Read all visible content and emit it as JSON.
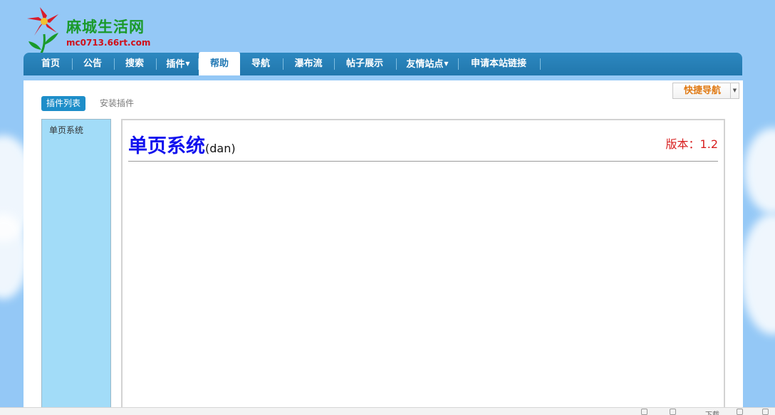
{
  "site": {
    "name": "麻城生活网",
    "url": "mc0713.66rt.com"
  },
  "nav": [
    {
      "label": "首页",
      "dropdown": false,
      "active": false
    },
    {
      "label": "公告",
      "dropdown": false,
      "active": false
    },
    {
      "label": "搜索",
      "dropdown": false,
      "active": false
    },
    {
      "label": "插件",
      "dropdown": true,
      "active": false
    },
    {
      "label": "帮助",
      "dropdown": false,
      "active": true
    },
    {
      "label": "导航",
      "dropdown": false,
      "active": false
    },
    {
      "label": "瀑布流",
      "dropdown": false,
      "active": false
    },
    {
      "label": "帖子展示",
      "dropdown": false,
      "active": false
    },
    {
      "label": "友情站点",
      "dropdown": true,
      "active": false
    },
    {
      "label": "申请本站链接",
      "dropdown": false,
      "active": false
    }
  ],
  "quick_nav": {
    "label": "快捷导航"
  },
  "tabs": {
    "active": "插件列表",
    "inactive": "安装插件"
  },
  "sidebar": {
    "items": [
      {
        "label": "单页系统"
      }
    ]
  },
  "plugin": {
    "title": "单页系统",
    "id": "(dan)",
    "version": "版本：1.2"
  },
  "status_bar": {
    "text": "下载"
  },
  "colors": {
    "background": "#94c8f6",
    "nav_bar": "#2177ad",
    "active_tab": "#1e8ec9",
    "sidebar": "#a2dcf8",
    "title": "#1111ee",
    "version": "#d82020",
    "quick_nav_text": "#e07a14",
    "site_name": "#1a9a2a",
    "site_url": "#d0101a"
  }
}
